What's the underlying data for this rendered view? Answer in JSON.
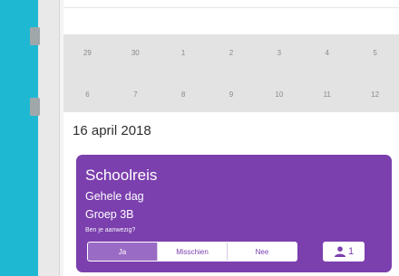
{
  "calendar": {
    "week1": [
      "29",
      "30",
      "1",
      "2",
      "3",
      "4",
      "5"
    ],
    "week2": [
      "6",
      "7",
      "8",
      "9",
      "10",
      "11",
      "12"
    ]
  },
  "date_heading": "16 april 2018",
  "event": {
    "title": "Schoolreis",
    "time": "Gehele dag",
    "group": "Groep 3B",
    "question": "Ben je aanwezig?",
    "rsvp": {
      "yes": "Ja",
      "maybe": "Misschien",
      "no": "Nee",
      "selected": "yes"
    },
    "attendee_icon": "person-icon",
    "attendee_count": "1",
    "color": "#7b3fae"
  },
  "sidebar_color": "#1fb8d3"
}
